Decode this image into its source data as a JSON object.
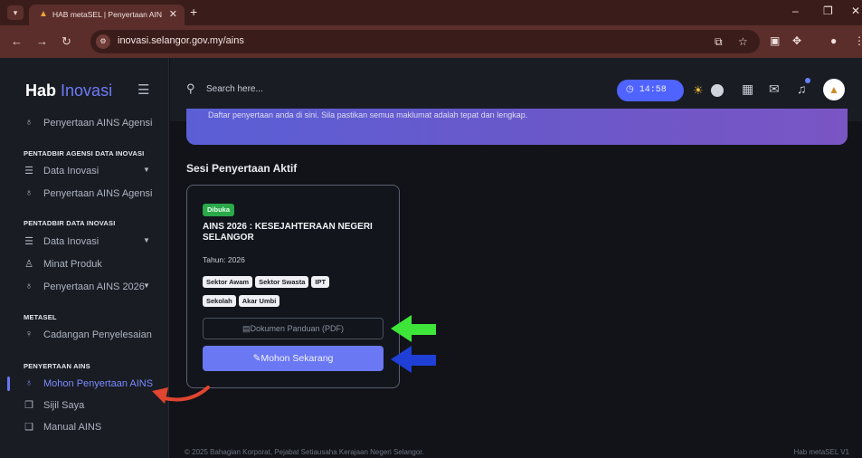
{
  "browser": {
    "tab_title": "HAB metaSEL | Penyertaan AIN",
    "url": "inovasi.selangor.gov.my/ains"
  },
  "app": {
    "brand_bold": "Hab",
    "brand_light": "Inovasi"
  },
  "sidebar": {
    "top_item": "Penyertaan AINS Agensi",
    "heading_1": "PENTADBIR AGENSI DATA INOVASI",
    "data_inovasi_1": "Data Inovasi",
    "penyertaan_agensi_2": "Penyertaan AINS Agensi",
    "heading_2": "PENTADBIR DATA INOVASI",
    "data_inovasi_2": "Data Inovasi",
    "minat_produk": "Minat Produk",
    "penyertaan_2026": "Penyertaan AINS 2026",
    "heading_3": "METASEL",
    "cadangan": "Cadangan Penyelesaian",
    "heading_4": "PENYERTAAN AINS",
    "mohon": "Mohon Penyertaan AINS",
    "sijil": "Sijil Saya",
    "manual": "Manual AINS"
  },
  "topbar": {
    "search_placeholder": "Search here...",
    "clock": "14:58"
  },
  "main": {
    "banner_text": "Daftar penyertaan anda di sini. Sila pastikan semua maklumat adalah tepat dan lengkap.",
    "section_title": "Sesi Penyertaan Aktif",
    "card": {
      "badge": "Dibuka",
      "title": "AINS 2026 : KESEJAHTERAAN NEGERI SELANGOR",
      "year": "Tahun: 2026",
      "tags": [
        "Sektor Awam",
        "Sektor Swasta",
        "IPT",
        "Sekolah",
        "Akar Umbi"
      ],
      "pdf_button": "Dokumen Panduan (PDF)",
      "apply_button": "Mohon Sekarang"
    }
  },
  "footer": {
    "left": "© 2025 Bahagian Korporat, Pejabat Setiausaha Kerajaan Negeri Selangor.",
    "right": "Hab metaSEL V1"
  },
  "colors": {
    "accent": "#6b78f3",
    "arrow_green": "#3ee63a",
    "arrow_blue": "#1f3fd6",
    "arrow_red": "#e0452f"
  }
}
